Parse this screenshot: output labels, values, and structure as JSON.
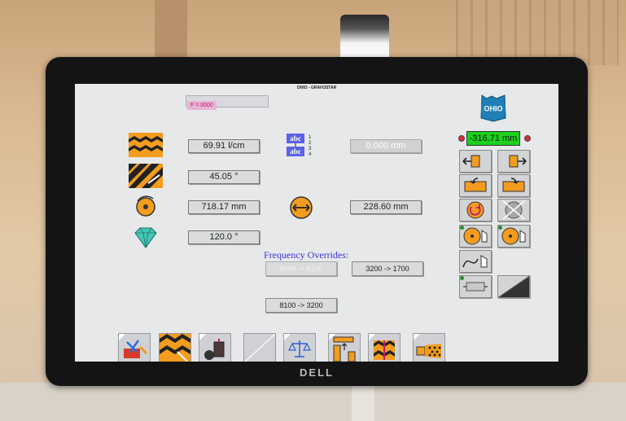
{
  "window": {
    "title": "OHIO - GRAVOSTAR"
  },
  "monitor": {
    "brand": "DELL"
  },
  "f_readout": "F = 0000",
  "logo": {
    "text": "OHIO",
    "color": "#1f7fb6"
  },
  "parameters": [
    {
      "icon": "screen-pattern-icon",
      "value": "69.91 l/cm"
    },
    {
      "icon": "screen-angle-icon",
      "value": "45.05 °"
    },
    {
      "icon": "cylinder-circumference-icon",
      "value": "718.17 mm"
    },
    {
      "icon": "stylus-diamond-icon",
      "value": "120.0 °"
    }
  ],
  "text_icon": {
    "text": "abc",
    "digits": [
      "1",
      "2",
      "3",
      "4"
    ]
  },
  "right_params": [
    {
      "icon": "text-layout-icon",
      "value": "0.000 mm",
      "disabled": true
    },
    {
      "icon": "cylinder-width-icon",
      "value": "228.60 mm",
      "disabled": false
    }
  ],
  "frequency_overrides": {
    "label": "Frequency Overrides:",
    "buttons": [
      {
        "label": "8000 -> 8100",
        "disabled": true
      },
      {
        "label": "3200 -> 1700",
        "disabled": false
      },
      {
        "label": "8100 -> 3200",
        "disabled": false
      }
    ]
  },
  "position_readout": "-316.71 mm",
  "colors": {
    "accent_green": "#1cd11c",
    "freq_label": "#3a32d8",
    "orange": "#f39c1e"
  }
}
